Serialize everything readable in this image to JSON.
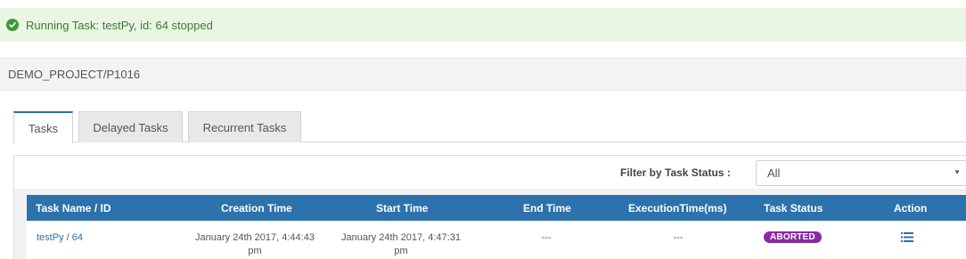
{
  "alert": {
    "icon": "check-circle-icon",
    "message": "Running Task: testPy, id: 64 stopped",
    "color": "#3c7a32"
  },
  "breadcrumb": {
    "path": "DEMO_PROJECT/P1016"
  },
  "tabs": [
    {
      "label": "Tasks",
      "active": true
    },
    {
      "label": "Delayed Tasks",
      "active": false
    },
    {
      "label": "Recurrent Tasks",
      "active": false
    }
  ],
  "filter": {
    "label": "Filter by Task Status :",
    "selected": "All"
  },
  "table": {
    "headers": [
      "Task Name / ID",
      "Creation Time",
      "Start Time",
      "End Time",
      "ExecutionTime(ms)",
      "Task Status",
      "Action"
    ],
    "rows": [
      {
        "task": "testPy / 64",
        "creation_time": "January 24th 2017, 4:44:43 pm",
        "start_time": "January 24th 2017, 4:47:31 pm",
        "end_time": "---",
        "execution_time": "---",
        "status": "ABORTED",
        "status_color": "#8a2aa1",
        "action_icon": "list-icon"
      }
    ]
  },
  "colors": {
    "header_bg": "#2c72ad",
    "alert_bg": "#eaf6e3",
    "accent": "#2a6fa8"
  }
}
